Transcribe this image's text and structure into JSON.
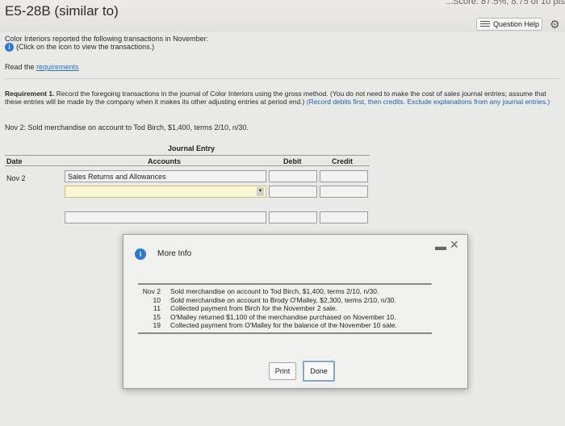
{
  "header": {
    "title": "E5-28B (similar to)",
    "score": "...Score: 87.5%, 8.75 of 10 pts",
    "help_label": "Question Help"
  },
  "intro": {
    "line1": "Color Interiors reported the following transactions in November:",
    "line2": "(Click on the icon to view the transactions.)",
    "read_prefix": "Read the ",
    "requirements_link": "requirements"
  },
  "requirement": {
    "label": "Requirement 1.",
    "text": " Record the foregoing transactions in the journal of Color Interiors using the gross method. (You do not need to make the cost of sales journal entries; assume that these entries will be made by the company when it makes its other adjusting entries at period end.) ",
    "hint": "(Record debits first, then credits. Exclude explanations from any journal entries.)",
    "task": "Nov 2: Sold merchandise on account to Tod Birch, $1,400, terms 2/10, n/30."
  },
  "journal": {
    "title": "Journal Entry",
    "headers": {
      "date": "Date",
      "accounts": "Accounts",
      "debit": "Debit",
      "credit": "Credit"
    },
    "rows": [
      {
        "date": "Nov 2",
        "account": "Sales Returns and Allowances",
        "debit": "",
        "credit": ""
      },
      {
        "date": "",
        "account": "",
        "debit": "",
        "credit": ""
      },
      {
        "date": "",
        "account": "",
        "debit": "",
        "credit": ""
      }
    ]
  },
  "modal": {
    "title": "More Info",
    "transactions": [
      {
        "day": "Nov 2",
        "desc": "Sold merchandise on account to Tod Birch, $1,400, terms 2/10, n/30."
      },
      {
        "day": "10",
        "desc": "Sold merchandise on account to Brody O'Malley, $2,300, terms 2/10, n/30."
      },
      {
        "day": "11",
        "desc": "Collected payment from Birch for the November 2 sale."
      },
      {
        "day": "15",
        "desc": "O'Malley returned $1,100 of the merchandise purchased on November 10."
      },
      {
        "day": "19",
        "desc": "Collected payment from O'Malley for the balance of the November 10 sale."
      }
    ],
    "print_label": "Print",
    "done_label": "Done"
  }
}
